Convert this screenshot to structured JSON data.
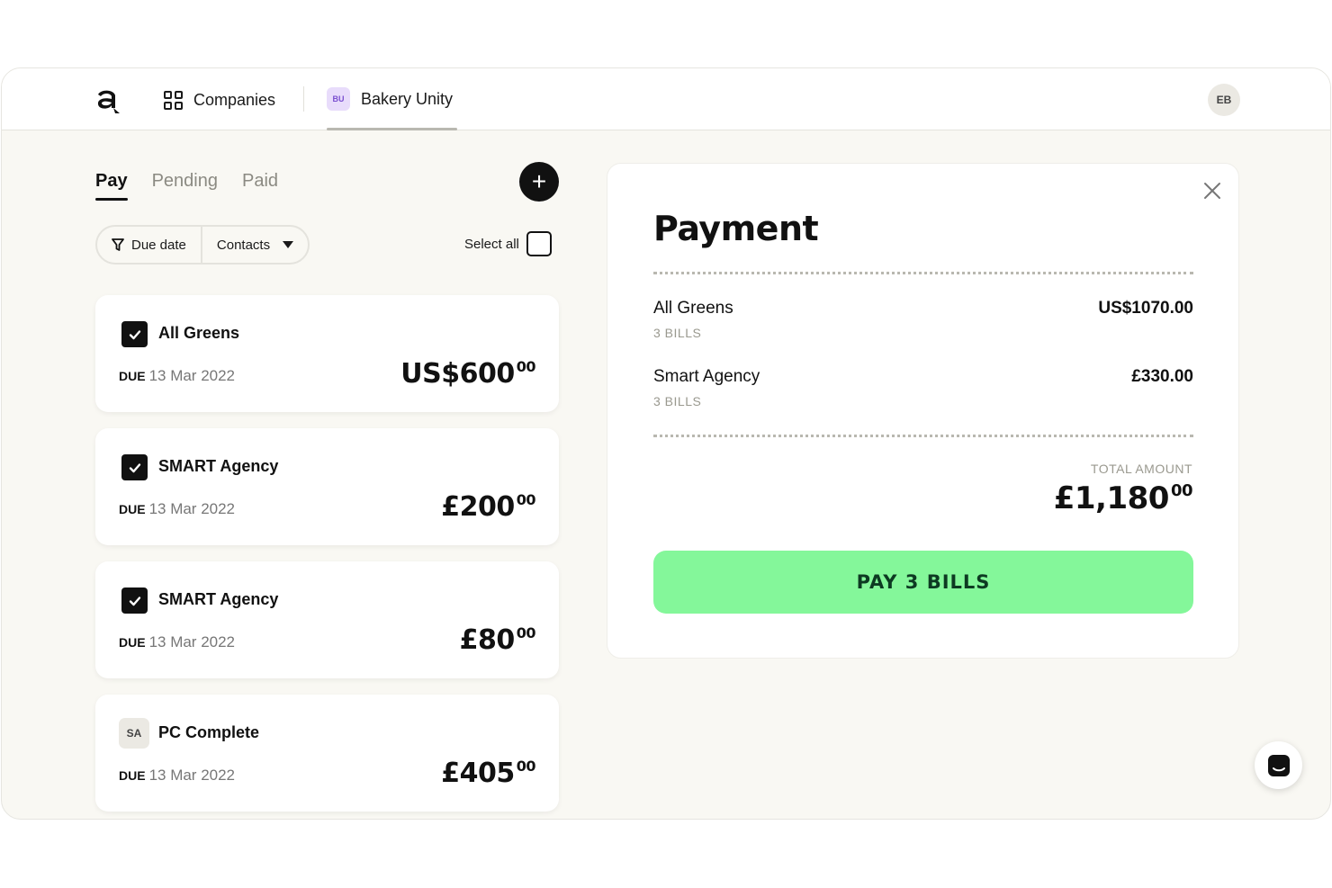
{
  "nav": {
    "companies_label": "Companies",
    "company_initials": "BU",
    "company_name": "Bakery Unity",
    "user_initials": "EB"
  },
  "tabs": [
    {
      "label": "Pay",
      "active": true
    },
    {
      "label": "Pending",
      "active": false
    },
    {
      "label": "Paid",
      "active": false
    }
  ],
  "add_button": "+",
  "filters": {
    "due_date": "Due date",
    "contacts": "Contacts",
    "select_all": "Select all"
  },
  "bills": [
    {
      "name": "All Greens",
      "checked": true,
      "initials": "",
      "due_label": "DUE",
      "due_date": "13 Mar 2022",
      "amount": "US$600",
      "cents": "00"
    },
    {
      "name": "SMART Agency",
      "checked": true,
      "initials": "",
      "due_label": "DUE",
      "due_date": "13 Mar 2022",
      "amount": "£200",
      "cents": "00"
    },
    {
      "name": "SMART Agency",
      "checked": true,
      "initials": "",
      "due_label": "DUE",
      "due_date": "13 Mar 2022",
      "amount": "£80",
      "cents": "00"
    },
    {
      "name": "PC Complete",
      "checked": false,
      "initials": "SA",
      "due_label": "DUE",
      "due_date": "13 Mar 2022",
      "amount": "£405",
      "cents": "00"
    }
  ],
  "payment": {
    "title": "Payment",
    "rows": [
      {
        "name": "All Greens",
        "count": "3 BILLS",
        "amount": "US$1070.00"
      },
      {
        "name": "Smart Agency",
        "count": "3 BILLS",
        "amount": "£330.00"
      }
    ],
    "total_label": "TOTAL AMOUNT",
    "total_amount": "£1,180",
    "total_cents": "00",
    "pay_button": "PAY 3 BILLS"
  },
  "colors": {
    "accent_green": "#84f79a",
    "badge_purple": "#e8dcfb",
    "background": "#f9f8f3"
  }
}
